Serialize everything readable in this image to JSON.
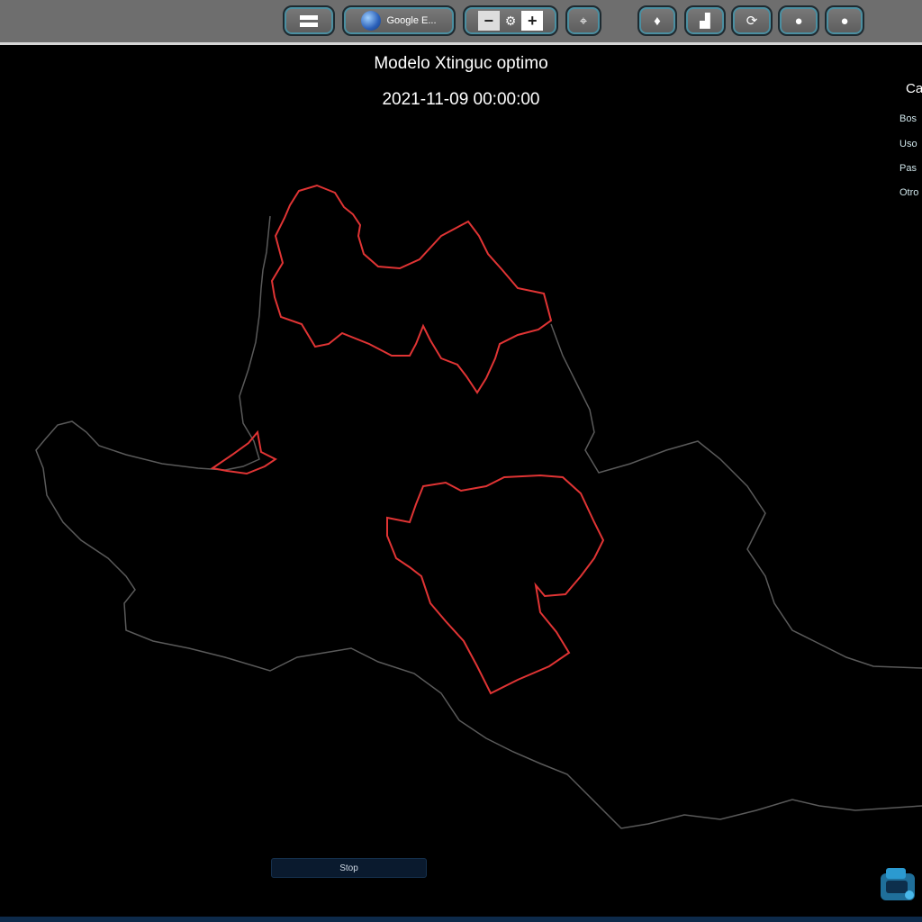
{
  "toolbar": {
    "layers_icon": "hamburger-menu-icon",
    "basemap_label": "Google E...",
    "basemap_icon": "globe-icon",
    "zoom_out": "−",
    "zoom_in": "+",
    "zoom_gear": "⚙",
    "center_icon": "⌖",
    "tools": [
      {
        "icon": "drop-icon",
        "glyph": "♦"
      },
      {
        "icon": "bar-chart-icon",
        "glyph": "▟"
      },
      {
        "icon": "refresh-icon",
        "glyph": "⟳"
      },
      {
        "icon": "info-icon",
        "glyph": "●"
      },
      {
        "icon": "marker-icon",
        "glyph": "●"
      }
    ]
  },
  "map": {
    "title": "Modelo Xtinguc optimo",
    "timestamp": "2021-11-09 00:00:00"
  },
  "legend": {
    "title": "Ca",
    "items": [
      "Bos",
      "Uso",
      "Pas",
      "Otro"
    ]
  },
  "controls": {
    "play_label": "Stop"
  },
  "colors": {
    "boundary": "#5a5a5a",
    "zone": "#e03434",
    "accent": "#4b8fa1"
  }
}
